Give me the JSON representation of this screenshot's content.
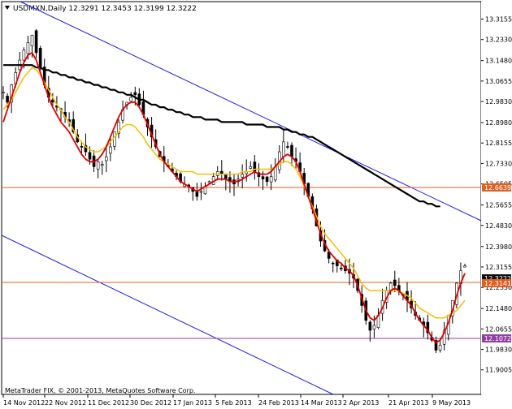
{
  "window": {
    "symbol_header": "USDMXN,Daily  12.3291 12.3453 12.3199 12.3222",
    "copyright": "MetaTrader FIX, © 2001-2013, MetaQuotes Software Corp."
  },
  "colors": {
    "background": "#ffffff",
    "candles": "#000000",
    "ma_fast": "#e00000",
    "ma_mid": "#f0c000",
    "ma_slow": "#000000",
    "channel": "#2020e0",
    "hline_orange": "#e06020",
    "hline_purple": "#9040a0",
    "price_tag_dark": "#101010"
  },
  "chart_data": {
    "type": "candlestick",
    "y_ticks": [
      "13.3155",
      "13.2330",
      "13.1480",
      "13.0655",
      "12.9830",
      "12.8980",
      "12.8155",
      "12.7330",
      "12.6505",
      "12.5655",
      "12.4830",
      "12.3980",
      "12.3155",
      "12.2330",
      "12.1480",
      "12.0655",
      "11.9830",
      "11.9005"
    ],
    "x_ticks": [
      "14 Nov 2012",
      "22 Nov 2012",
      "11 Dec 2012",
      "30 Dec 2012",
      "17 Jan 2013",
      "5 Feb 2013",
      "24 Feb 2013",
      "14 Mar 2013",
      "2 Apr 2013",
      "21 Apr 2013",
      "9 May 2013"
    ],
    "ylim": [
      11.88,
      13.34
    ],
    "price_labels": [
      {
        "name": "level-orange-upper",
        "value": "12.6639"
      },
      {
        "name": "level-current",
        "value": "12.3222"
      },
      {
        "name": "level-orange-lower",
        "value": "12.3141"
      },
      {
        "name": "level-purple",
        "value": "12.1072"
      }
    ],
    "closes": [
      13.02,
      12.98,
      13.05,
      13.1,
      13.15,
      13.19,
      13.22,
      13.25,
      13.18,
      13.12,
      13.05,
      13.0,
      12.98,
      12.96,
      12.95,
      12.92,
      12.9,
      12.86,
      12.82,
      12.8,
      12.78,
      12.75,
      12.72,
      12.74,
      12.73,
      12.76,
      12.8,
      12.86,
      12.9,
      12.95,
      12.98,
      13.0,
      13.01,
      12.97,
      12.93,
      12.88,
      12.84,
      12.8,
      12.76,
      12.74,
      12.72,
      12.7,
      12.68,
      12.66,
      12.65,
      12.64,
      12.62,
      12.6,
      12.62,
      12.64,
      12.66,
      12.68,
      12.7,
      12.69,
      12.67,
      12.66,
      12.65,
      12.67,
      12.69,
      12.7,
      12.72,
      12.7,
      12.68,
      12.67,
      12.66,
      12.68,
      12.72,
      12.78,
      12.82,
      12.8,
      12.76,
      12.74,
      12.7,
      12.65,
      12.6,
      12.55,
      12.48,
      12.42,
      12.38,
      12.35,
      12.33,
      12.32,
      12.31,
      12.3,
      12.29,
      12.27,
      12.22,
      12.16,
      12.1,
      12.06,
      12.08,
      12.12,
      12.18,
      12.22,
      12.25,
      12.24,
      12.22,
      12.2,
      12.18,
      12.15,
      12.12,
      12.1,
      12.08,
      12.05,
      12.02,
      11.98,
      12.0,
      12.06,
      12.12,
      12.18,
      12.25,
      12.3,
      12.32
    ],
    "ma_fast": [
      12.9,
      12.95,
      13.0,
      13.05,
      13.1,
      13.14,
      13.17,
      13.18,
      13.15,
      13.1,
      13.05,
      13.0,
      12.96,
      12.93,
      12.9,
      12.88,
      12.86,
      12.83,
      12.8,
      12.77,
      12.75,
      12.74,
      12.74,
      12.75,
      12.77,
      12.8,
      12.84,
      12.88,
      12.92,
      12.95,
      12.97,
      12.98,
      12.98,
      12.96,
      12.93,
      12.89,
      12.85,
      12.81,
      12.77,
      12.74,
      12.72,
      12.7,
      12.68,
      12.66,
      12.65,
      12.64,
      12.63,
      12.62,
      12.63,
      12.64,
      12.65,
      12.66,
      12.67,
      12.67,
      12.67,
      12.66,
      12.66,
      12.66,
      12.67,
      12.68,
      12.69,
      12.7,
      12.69,
      12.69,
      12.69,
      12.7,
      12.72,
      12.74,
      12.76,
      12.77,
      12.76,
      12.74,
      12.7,
      12.65,
      12.6,
      12.55,
      12.5,
      12.45,
      12.41,
      12.38,
      12.36,
      12.34,
      12.33,
      12.31,
      12.3,
      12.28,
      12.24,
      12.19,
      12.14,
      12.11,
      12.1,
      12.12,
      12.15,
      12.19,
      12.22,
      12.23,
      12.22,
      12.2,
      12.18,
      12.16,
      12.13,
      12.1,
      12.08,
      12.06,
      12.03,
      12.01,
      12.02,
      12.05,
      12.09,
      12.14,
      12.2,
      12.25,
      12.29
    ],
    "ma_mid": [
      12.95,
      12.97,
      12.99,
      13.02,
      13.05,
      13.08,
      13.1,
      13.12,
      13.11,
      13.09,
      13.06,
      13.03,
      13.0,
      12.97,
      12.95,
      12.92,
      12.9,
      12.87,
      12.84,
      12.82,
      12.8,
      12.79,
      12.78,
      12.78,
      12.79,
      12.8,
      12.82,
      12.84,
      12.86,
      12.88,
      12.89,
      12.89,
      12.88,
      12.86,
      12.84,
      12.81,
      12.79,
      12.77,
      12.75,
      12.74,
      12.73,
      12.72,
      12.71,
      12.7,
      12.7,
      12.7,
      12.7,
      12.69,
      12.69,
      12.69,
      12.69,
      12.69,
      12.69,
      12.69,
      12.69,
      12.69,
      12.69,
      12.69,
      12.7,
      12.7,
      12.7,
      12.71,
      12.71,
      12.71,
      12.71,
      12.71,
      12.72,
      12.73,
      12.74,
      12.74,
      12.73,
      12.71,
      12.68,
      12.64,
      12.6,
      12.56,
      12.52,
      12.48,
      12.45,
      12.43,
      12.41,
      12.39,
      12.37,
      12.35,
      12.33,
      12.31,
      12.28,
      12.25,
      12.23,
      12.22,
      12.22,
      12.22,
      12.22,
      12.22,
      12.22,
      12.22,
      12.22,
      12.21,
      12.2,
      12.19,
      12.17,
      12.15,
      12.14,
      12.13,
      12.12,
      12.11,
      12.11,
      12.11,
      12.12,
      12.13,
      12.14,
      12.16,
      12.18
    ],
    "ma_slow": [
      13.13,
      13.13,
      13.13,
      13.13,
      13.13,
      13.13,
      13.13,
      13.13,
      13.12,
      13.12,
      13.11,
      13.11,
      13.1,
      13.1,
      13.09,
      13.09,
      13.08,
      13.08,
      13.07,
      13.07,
      13.06,
      13.06,
      13.05,
      13.05,
      13.04,
      13.04,
      13.03,
      13.03,
      13.02,
      13.02,
      13.01,
      13.01,
      13.0,
      12.99,
      12.99,
      12.98,
      12.97,
      12.97,
      12.96,
      12.96,
      12.95,
      12.95,
      12.94,
      12.94,
      12.93,
      12.93,
      12.92,
      12.92,
      12.92,
      12.91,
      12.91,
      12.91,
      12.91,
      12.9,
      12.9,
      12.9,
      12.9,
      12.9,
      12.9,
      12.89,
      12.89,
      12.89,
      12.89,
      12.89,
      12.88,
      12.88,
      12.88,
      12.88,
      12.87,
      12.87,
      12.86,
      12.86,
      12.85,
      12.85,
      12.84,
      12.84,
      12.83,
      12.82,
      12.81,
      12.8,
      12.79,
      12.78,
      12.77,
      12.76,
      12.75,
      12.74,
      12.73,
      12.72,
      12.71,
      12.7,
      12.69,
      12.68,
      12.67,
      12.66,
      12.65,
      12.64,
      12.63,
      12.62,
      12.61,
      12.6,
      12.59,
      12.58,
      12.58,
      12.57,
      12.57,
      12.56,
      12.56
    ]
  }
}
